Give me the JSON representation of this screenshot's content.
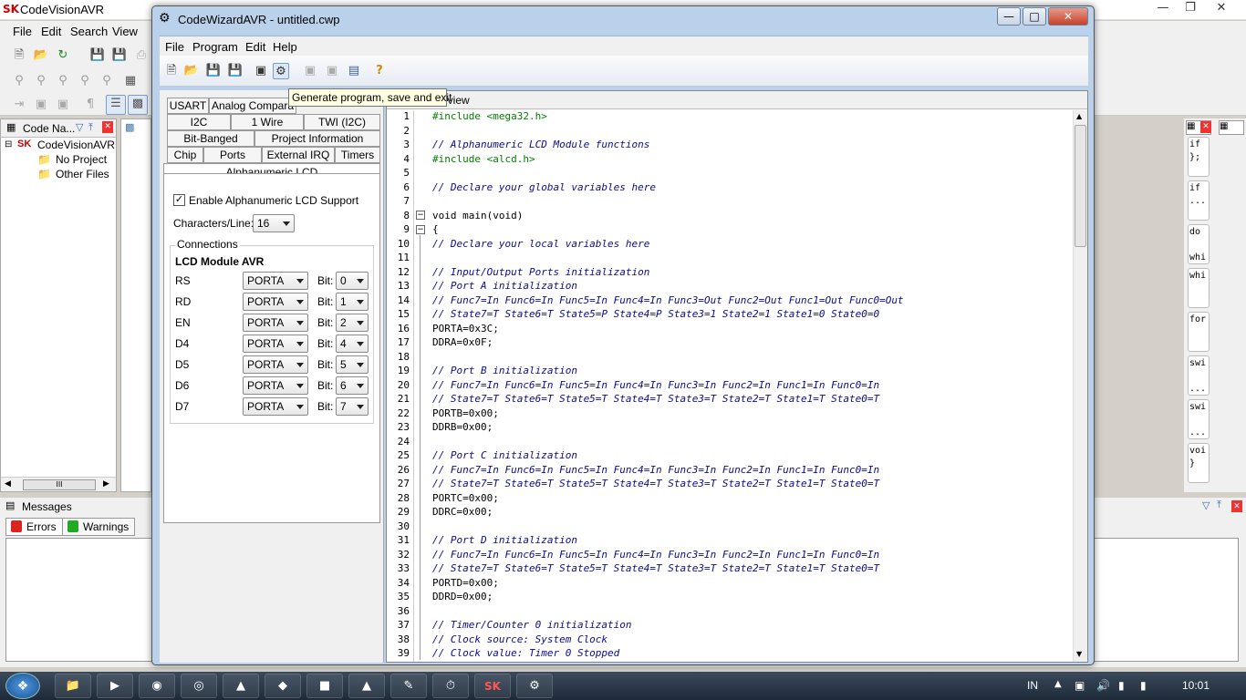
{
  "app": {
    "title": "CodeVisionAVR",
    "menu": [
      "File",
      "Edit",
      "Search",
      "View"
    ]
  },
  "left_pane": {
    "header": "Code Na...",
    "tree": [
      "CodeVisionAVR",
      "No Project",
      "Other Files"
    ],
    "scroll_label": "III"
  },
  "messages": {
    "title": "Messages",
    "tabs": [
      "Errors",
      "Warnings"
    ]
  },
  "right_snippets": [
    "if\n};",
    "if\n...",
    "do\n\nwhi",
    "whi",
    "for",
    "swi\n\n...",
    "swi\n\n...",
    "voi\n}"
  ],
  "wizard": {
    "title": "CodeWizardAVR - untitled.cwp",
    "menu": [
      "File",
      "Program",
      "Edit",
      "Help"
    ],
    "tooltip": "Generate program, save and exit",
    "editor_header": "review",
    "tabs_row1": [
      "USART",
      "Analog Compara"
    ],
    "tabs_row2": [
      "I2C",
      "1 Wire",
      "TWI (I2C)"
    ],
    "tabs_row3": [
      "Bit-Banged",
      "Project Information"
    ],
    "tabs_row4": [
      "Chip",
      "Ports",
      "External IRQ",
      "Timers"
    ],
    "active_tab": "Alphanumeric LCD",
    "enable_label": "Enable Alphanumeric LCD Support",
    "chars_label": "Characters/Line:",
    "chars_value": "16",
    "connections_label": "Connections",
    "lcd_module_label": "LCD Module AVR",
    "bit_label": "Bit:",
    "pins": [
      {
        "name": "RS",
        "port": "PORTA",
        "bit": "0"
      },
      {
        "name": "RD",
        "port": "PORTA",
        "bit": "1"
      },
      {
        "name": "EN",
        "port": "PORTA",
        "bit": "2"
      },
      {
        "name": "D4",
        "port": "PORTA",
        "bit": "4"
      },
      {
        "name": "D5",
        "port": "PORTA",
        "bit": "5"
      },
      {
        "name": "D6",
        "port": "PORTA",
        "bit": "6"
      },
      {
        "name": "D7",
        "port": "PORTA",
        "bit": "7"
      }
    ],
    "code_lines": [
      "#include <mega32.h>",
      "",
      "// Alphanumeric LCD Module functions",
      "#include <alcd.h>",
      "",
      "// Declare your global variables here",
      "",
      "void main(void)",
      "{",
      "// Declare your local variables here",
      "",
      "// Input/Output Ports initialization",
      "// Port A initialization",
      "// Func7=In Func6=In Func5=In Func4=In Func3=Out Func2=Out Func1=Out Func0=Out",
      "// State7=T State6=T State5=P State4=P State3=1 State2=1 State1=0 State0=0",
      "PORTA=0x3C;",
      "DDRA=0x0F;",
      "",
      "// Port B initialization",
      "// Func7=In Func6=In Func5=In Func4=In Func3=In Func2=In Func1=In Func0=In",
      "// State7=T State6=T State5=T State4=T State3=T State2=T State1=T State0=T",
      "PORTB=0x00;",
      "DDRB=0x00;",
      "",
      "// Port C initialization",
      "// Func7=In Func6=In Func5=In Func4=In Func3=In Func2=In Func1=In Func0=In",
      "// State7=T State6=T State5=T State4=T State3=T State2=T State1=T State0=T",
      "PORTC=0x00;",
      "DDRC=0x00;",
      "",
      "// Port D initialization",
      "// Func7=In Func6=In Func5=In Func4=In Func3=In Func2=In Func1=In Func0=In",
      "// State7=T State6=T State5=T State4=T State3=T State2=T State1=T State0=T",
      "PORTD=0x00;",
      "DDRD=0x00;",
      "",
      "// Timer/Counter 0 initialization",
      "// Clock source: System Clock",
      "// Clock value: Timer 0 Stopped"
    ]
  },
  "taskbar": {
    "lang": "IN",
    "time": "10:01"
  }
}
